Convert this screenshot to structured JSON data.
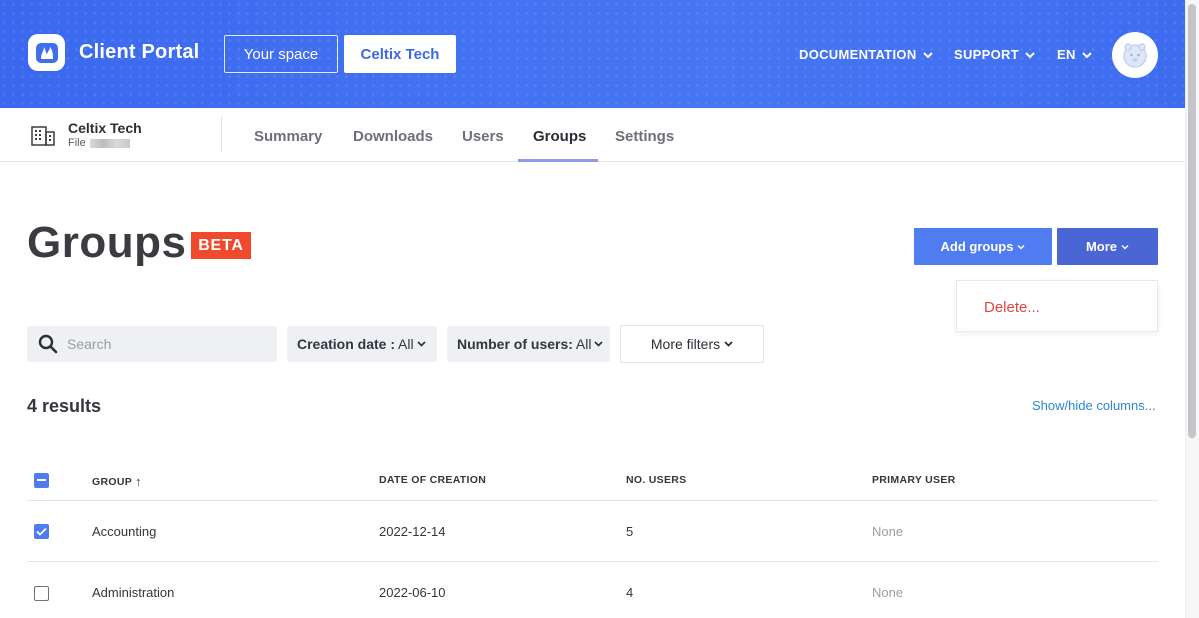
{
  "header": {
    "app_title": "Client Portal",
    "space_button": "Your space",
    "company_button": "Celtix Tech",
    "nav": {
      "documentation": "DOCUMENTATION",
      "support": "SUPPORT",
      "language": "EN"
    }
  },
  "org": {
    "name": "Celtix Tech",
    "file_label": "File"
  },
  "tabs": [
    {
      "label": "Summary"
    },
    {
      "label": "Downloads"
    },
    {
      "label": "Users"
    },
    {
      "label": "Groups"
    },
    {
      "label": "Settings"
    }
  ],
  "page": {
    "title": "Groups",
    "badge": "BETA",
    "add_button": "Add groups",
    "more_button": "More",
    "more_menu": {
      "delete": "Delete..."
    }
  },
  "filters": {
    "search_placeholder": "Search",
    "creation_date": {
      "label": "Creation date :",
      "value": "All"
    },
    "number_of_users": {
      "label": "Number of users:",
      "value": "All"
    },
    "more_filters": "More filters"
  },
  "results": {
    "count_text": "4 results",
    "show_hide": "Show/hide columns..."
  },
  "table": {
    "columns": {
      "group": "GROUP",
      "date": "DATE OF CREATION",
      "users": "NO. USERS",
      "primary": "PRIMARY USER"
    },
    "sort_indicator": "↑",
    "rows": [
      {
        "group": "Accounting",
        "date": "2022-12-14",
        "users": "5",
        "primary": "None",
        "checked": true
      },
      {
        "group": "Administration",
        "date": "2022-06-10",
        "users": "4",
        "primary": "None",
        "checked": false
      }
    ]
  },
  "colors": {
    "brand_blue": "#3f6ef0",
    "beta_red": "#ef4a2c",
    "delete_red": "#e04545",
    "link_blue": "#2e86d6"
  }
}
